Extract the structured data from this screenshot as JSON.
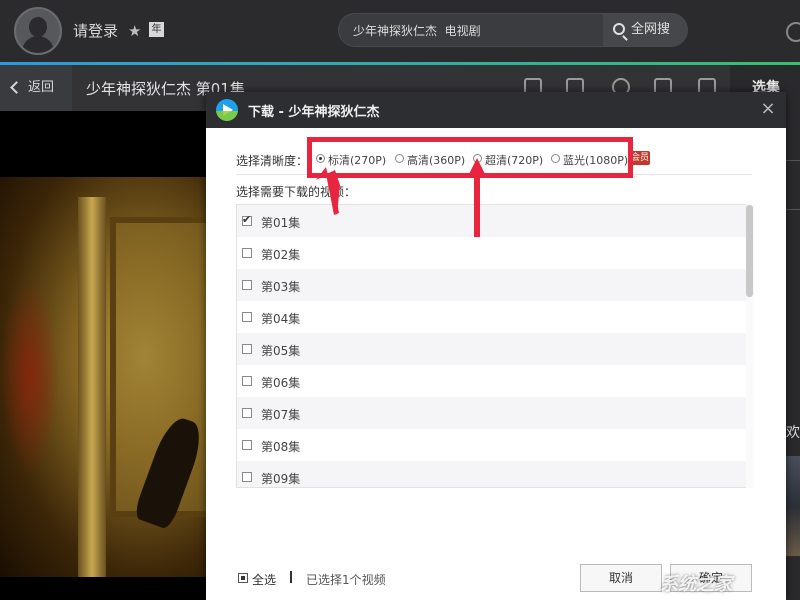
{
  "header": {
    "login_label": "请登录",
    "year_badge": "年",
    "search_value": "少年神探狄仁杰  电视剧",
    "search_button": "全网搜"
  },
  "subbar": {
    "back_label": "返回",
    "title": "少年神探狄仁杰 第01集",
    "right_tab": "选集",
    "right_text": "欢"
  },
  "dialog": {
    "title": "下载 - 少年神探狄仁杰",
    "close": "×",
    "quality_label": "选择清晰度：",
    "qualities": [
      {
        "label": "标清(270P)",
        "checked": true
      },
      {
        "label": "高清(360P)",
        "checked": false
      },
      {
        "label": "超清(720P)",
        "checked": false
      },
      {
        "label": "蓝光(1080P)",
        "checked": false
      }
    ],
    "vip_badge": "会员",
    "episodes_label": "选择需要下载的视频：",
    "episodes": [
      {
        "label": "第01集",
        "checked": true
      },
      {
        "label": "第02集",
        "checked": false
      },
      {
        "label": "第03集",
        "checked": false
      },
      {
        "label": "第04集",
        "checked": false
      },
      {
        "label": "第05集",
        "checked": false
      },
      {
        "label": "第06集",
        "checked": false
      },
      {
        "label": "第07集",
        "checked": false
      },
      {
        "label": "第08集",
        "checked": false
      },
      {
        "label": "第09集",
        "checked": false
      }
    ],
    "select_all": "全选",
    "selected_count": "已选择1个视频",
    "cancel": "取消",
    "ok": "确定"
  },
  "watermark": "系统之家",
  "colors": {
    "accent_blue": "#2a9be0",
    "annotation_red": "#e8253f",
    "header_dark": "#2b2b2d"
  }
}
